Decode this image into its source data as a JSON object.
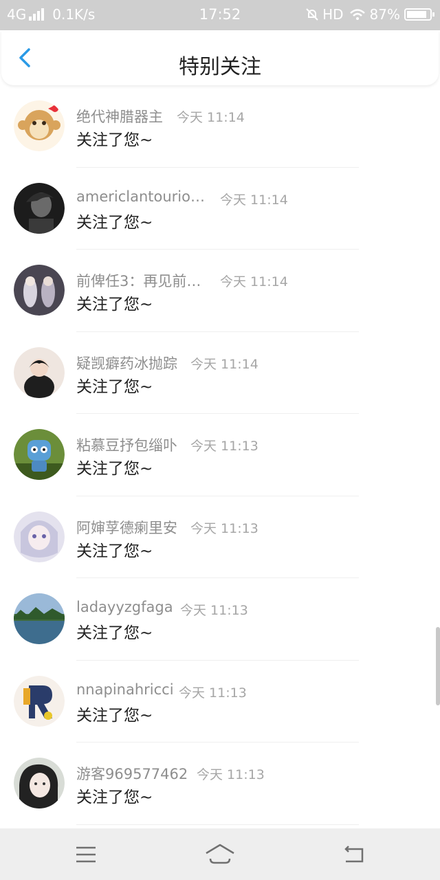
{
  "status_bar": {
    "network": "4G",
    "speed": "0.1K/s",
    "time": "17:52",
    "hd": "HD",
    "battery": "87%",
    "battery_level": 0.87
  },
  "header": {
    "title": "特别关注"
  },
  "items": [
    {
      "name": "绝代神腊器主",
      "time": "今天 11:14",
      "message": "关注了您~"
    },
    {
      "name": "americlantourios…",
      "time": "今天 11:14",
      "message": "关注了您~"
    },
    {
      "name": "前俾任3：再见前…",
      "time": "今天 11:14",
      "message": "关注了您~"
    },
    {
      "name": "疑觊癖药冰抛踪",
      "time": "今天 11:14",
      "message": "关注了您~"
    },
    {
      "name": "粘慕豆抒包缁卟",
      "time": "今天 11:13",
      "message": "关注了您~"
    },
    {
      "name": "阿婶莩德瘌里安",
      "time": "今天 11:13",
      "message": "关注了您~"
    },
    {
      "name": "ladayyzgfaga",
      "time": "今天 11:13",
      "message": "关注了您~"
    },
    {
      "name": "nnapinahricci",
      "time": "今天 11:13",
      "message": "关注了您~"
    },
    {
      "name": "游客969577462",
      "time": "今天 11:13",
      "message": "关注了您~"
    }
  ],
  "colors": {
    "accent": "#2a9ae6",
    "status_bar_bg": "#cfcfcf"
  }
}
